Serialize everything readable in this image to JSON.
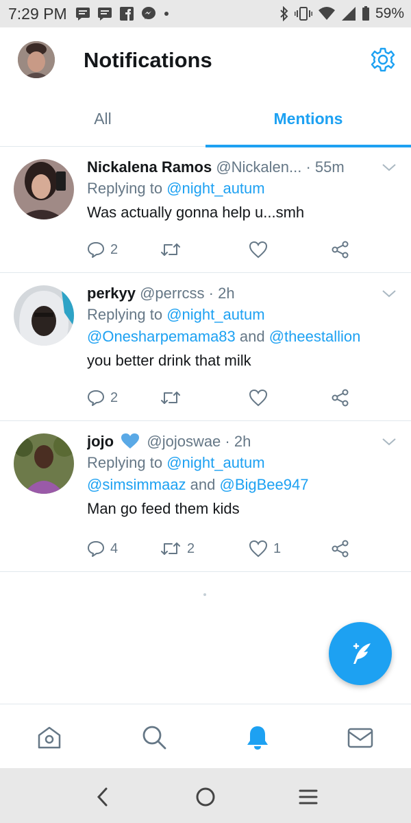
{
  "status_bar": {
    "time": "7:29 PM",
    "notification_icons": [
      "message-icon",
      "message-icon",
      "facebook-icon",
      "messenger-icon",
      "dot-icon"
    ],
    "right_icons": [
      "bluetooth-icon",
      "vibrate-icon",
      "wifi-icon",
      "signal-icon",
      "battery-icon"
    ],
    "battery": "59%"
  },
  "header": {
    "title": "Notifications",
    "settings_icon": "gear-icon"
  },
  "tabs": [
    {
      "label": "All",
      "active": false
    },
    {
      "label": "Mentions",
      "active": true
    }
  ],
  "tweets": [
    {
      "name": "Nickalena Ramos",
      "handle": "@Nickalen...",
      "time": " · 55m",
      "replying_prefix": "Replying to ",
      "replying_line1": "@night_autum",
      "replying_line2_a": "",
      "replying_line2_and": "",
      "replying_line2_b": "",
      "text": "Was actually gonna help u...smh",
      "replies": "2",
      "retweets": "",
      "likes": "",
      "verified_heart": false
    },
    {
      "name": "perkyy",
      "handle": "@perrcss",
      "time": " · 2h",
      "replying_prefix": "Replying to ",
      "replying_line1": "@night_autum",
      "replying_line2_a": "@Onesharpemama83",
      "replying_line2_and": " and ",
      "replying_line2_b": "@theestallion",
      "text": "you better drink that milk",
      "replies": "2",
      "retweets": "",
      "likes": "",
      "verified_heart": false
    },
    {
      "name": "jojo",
      "handle": "@jojoswae",
      "time": " · 2h",
      "replying_prefix": "Replying to ",
      "replying_line1": "@night_autum",
      "replying_line2_a": "@simsimmaaz",
      "replying_line2_and": " and ",
      "replying_line2_b": "@BigBee947",
      "text": "Man go feed them kids",
      "replies": "4",
      "retweets": "2",
      "likes": "1",
      "verified_heart": true
    }
  ],
  "bottom_nav": [
    "home-icon",
    "search-icon",
    "notifications-icon",
    "messages-icon"
  ],
  "colors": {
    "accent": "#1da1f2",
    "text_primary": "#14171a",
    "text_secondary": "#657786",
    "divider": "#e1e8ed",
    "heart_blue": "#5aa9e6"
  }
}
